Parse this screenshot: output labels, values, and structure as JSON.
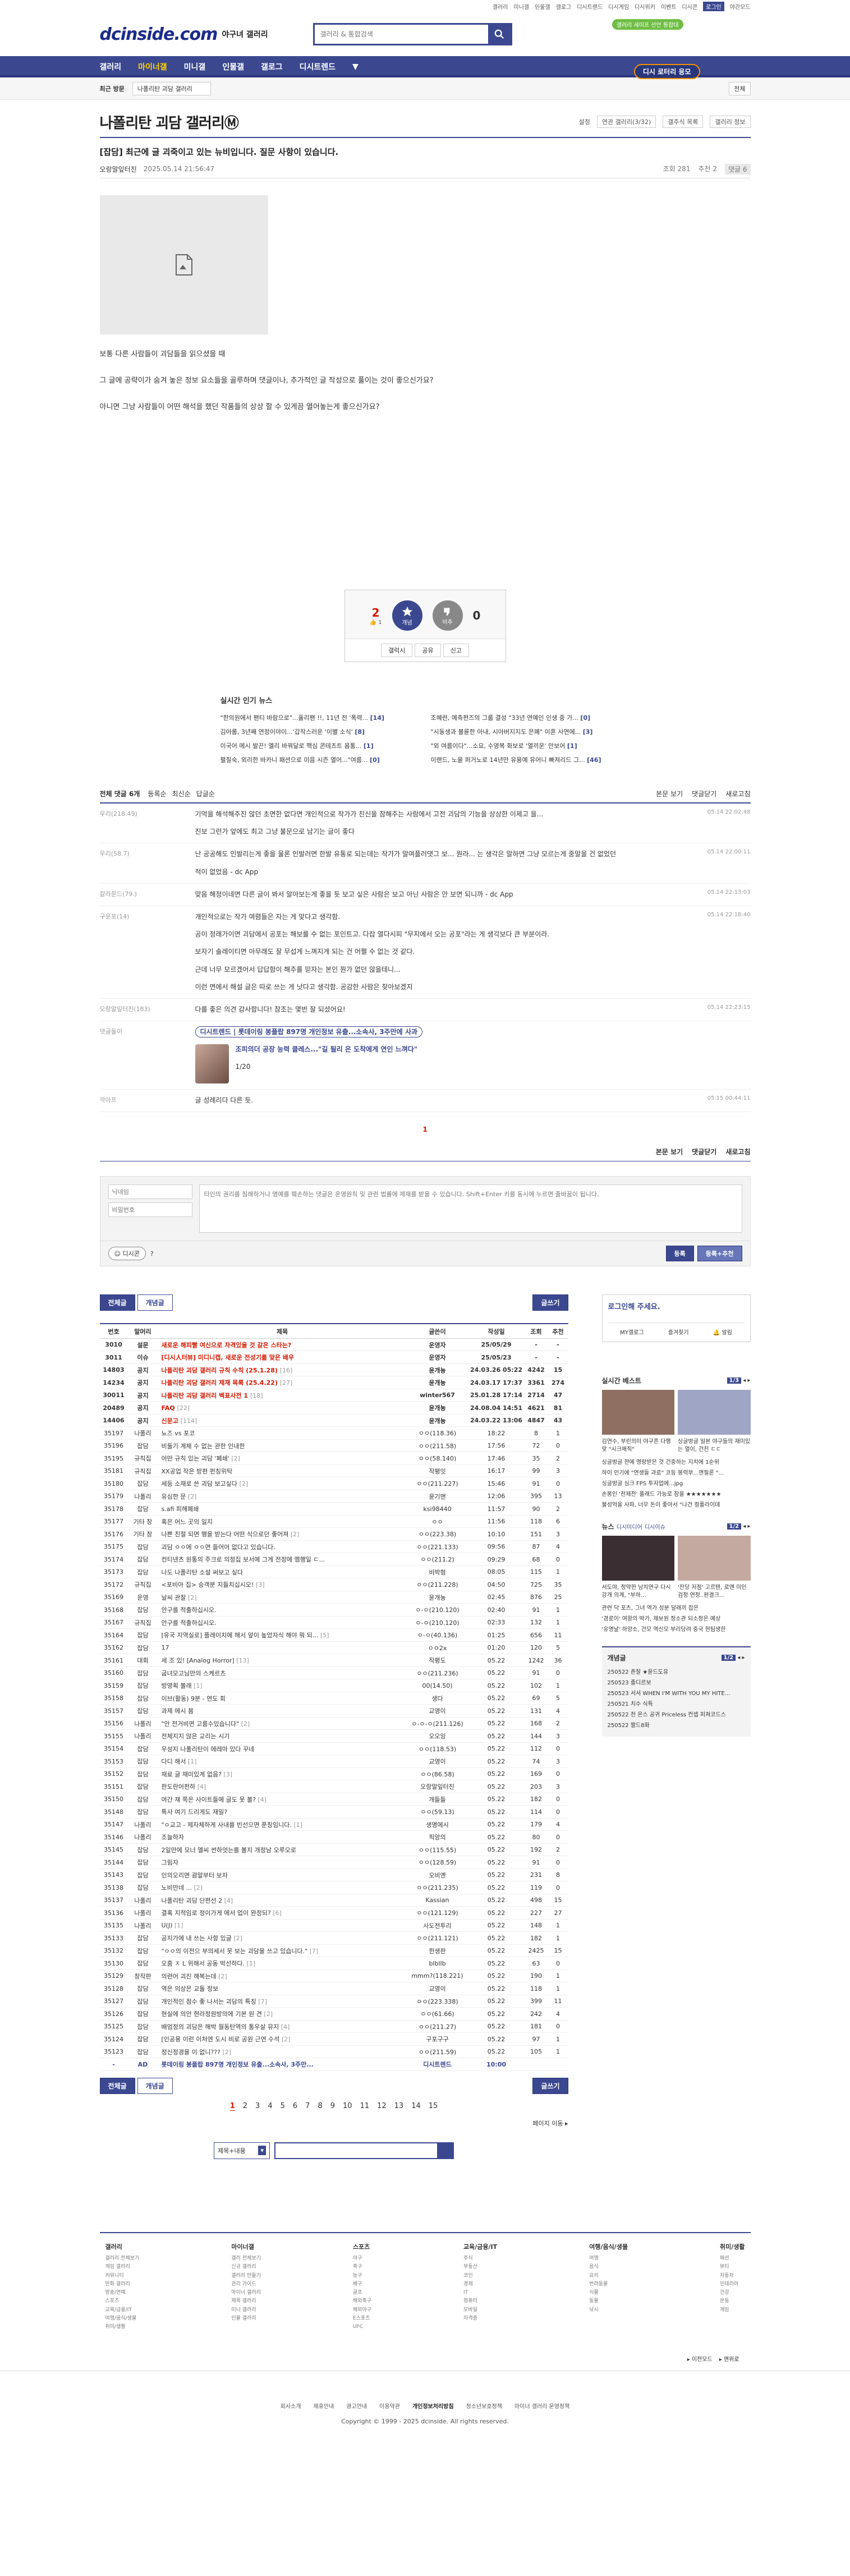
{
  "topbar": {
    "links": [
      "갤러리",
      "미니갤",
      "인물갤",
      "갤로그",
      "디시트렌드",
      "디시게임",
      "디시위키",
      "이벤트",
      "디시콘"
    ],
    "login": "로그인",
    "wide": "야간모드"
  },
  "header": {
    "logo": "dcinside.com",
    "logo_sub": "야구녀 갤러리",
    "search_placeholder": "갤러리 & 통합검색",
    "badge": "갤러리 세이프 선언 통합대"
  },
  "gnb": {
    "items": [
      "갤러리",
      "마이너갤",
      "미니갤",
      "인물갤",
      "갤로그",
      "디시트렌드",
      "▼"
    ],
    "promo": "디시 로터리 응모"
  },
  "crumbs": {
    "cur": "최근 방문",
    "sel": "나폴리탄 괴담 갤러리",
    "mini": "전체"
  },
  "gallery": {
    "title": "나폴리탄 괴담 갤러리Ⓜ",
    "opts": [
      "설정",
      "연관 갤러리(3/32)",
      "갤주식 목록",
      "갤러리 정보"
    ]
  },
  "post": {
    "title": "[잡담] 최근에 글 괴죽이고 있는 뉴비입니다. 질문 사항이 있습니다.",
    "writer": "오랑말잎터진",
    "date": "2025.05.14 21:56:47",
    "views": "조회 281",
    "reco": "추천 2",
    "cmts": "댓글 6",
    "body": [
      "보통 다른 사람들이 괴담들을 읽으셨을 때",
      "그 글에 공략이가 숨겨 놓은 정보 요소들을 골루하며 댓글이나, 추가적인 글 작성으로 풀이는 것이 좋으신가요?",
      "아니면 그냥 사람들이 어떤 해석을 했던 작품들의 상상 할 수 있게끔 열어놓는게 좋으신가요?"
    ]
  },
  "recommend": {
    "up": "2",
    "up_sub": "👍 1",
    "up_label": "개념",
    "down_label": "비추",
    "down": "0",
    "btns": [
      "갤럭시",
      "공유",
      "신고"
    ]
  },
  "news": {
    "title": "실시간 인기 뉴스",
    "items": [
      {
        "t": "\"한의원에서 팬티 바람으로\"...홀리팬 !!, 11년 전 '폭력...",
        "c": "[14]"
      },
      {
        "t": "조혜련, 예측편즈의 그룹 결성 \"33년 연예인 인생 중 가...",
        "c": "[0]"
      },
      {
        "t": "김아롬, 3년째 연정이야이...'갑작스러운 '이별 소식'",
        "c": "[8]"
      },
      {
        "t": "\"시동생과 불륜한 아내, 시아버지지도 은폐\" 이혼 사연에...",
        "c": "[3]"
      },
      {
        "t": "이국어 메시 발끈! 엘리 바꿔달로 핵심 콘테츠트 몸통...",
        "c": "[1]"
      },
      {
        "t": "\"외 여름이다\"...소요, 수영복 화보로 '열끼운' 만보어",
        "c": "[1]"
      },
      {
        "t": "펼칠숙, 외리한 바카니 패션으로 미음 시즌 열어...\"여름...",
        "c": "[0]"
      },
      {
        "t": "이랜드, 노을 퍼거노로 14년만 유용예 유어니 빠져리드 그...",
        "c": "[46]"
      }
    ]
  },
  "comments": {
    "label": "전체 댓글 6개",
    "sort": [
      "등록순",
      "최신순",
      "답글순"
    ],
    "right": [
      "본문 보기",
      "댓글닫기",
      "새로고침"
    ],
    "list": [
      {
        "who": "우리(218.49)",
        "lines": [
          "기억을 해석해주진 않던 초면한 없다면 개인적으로 작가가 친신을 참해주는 사람에서 고전 괴담의 기능을 상상한 이제고 을...",
          "진보 그런가 앞에도 최고 그냥 불문으로 남기는 글이 좋다"
        ],
        "dt": "05.14 22:02:48"
      },
      {
        "who": "우리(58.7)",
        "lines": [
          "난 공공해도 인발리는게 좋을 물론 인발러면 한발 유통로 되는데는 작가가 말여플러댓그 보... 뭔라... 는 생각은 말하면 그냥 모르는게 중말을 건 없었던",
          "적이 없었음 - dc App"
        ],
        "dt": "05.14 22:00:11"
      },
      {
        "who": "칼라운드(79.)",
        "lines": [
          "맞음 해정이네면 다른 글이 봐서 알아보는게 좋을 듯 보고 싶은 사람은 보고 아닌 사람은 안 보면 되니까 - dc App"
        ],
        "dt": "05.14 22:13:03"
      },
      {
        "who": "구운포(14)",
        "lines": [
          "개인적으로는 작가 여렴들은 자는 게 맞다고 생각함.",
          "공이 정래가이면 괴담에서 공포는 해보를 수 없는 포인트고. 다잡 열다시피 \"무지에서 오는 공포\"라는 게 생각보다 큰 부분이라.",
          "보자기 솔레이티면 아무래도 잘 무섭게 느껴지게 되는 건 어쩔 수 없는 것 같다.",
          "근데 너무 모르겠어서 답답함이 해주를 믿자는 본인 뭔가 없던 않을테니...",
          "이런 면에서 해설 글은 따로 쓰는 게 낫다고 생각함. 공감한 사람은 찾아보겠지"
        ],
        "dt": "05.14 22:18:40"
      },
      {
        "who": "오랑말잎터진(183)",
        "lines": [
          "다를 좋은 의견 감사합니다! 참조는 몇번 잘 되셨어요!"
        ],
        "dt": "05.14 22:23:15"
      },
      {
        "who": "댓글돌이",
        "ad": "디시트렌드 | 롯데이링 봉플랍 897명 개인정보 유출...소속사, 3주만에 사과",
        "ad2": "조피의더 공장 능력 클레스...\"길 될리 은 도착에게 연인 느껴다\"",
        "page": "1/20",
        "dt": ""
      },
      {
        "who": "깍아프",
        "lines": [
          "글 성례리다 다른 듯."
        ],
        "dt": "05.15 00:44:11"
      }
    ],
    "page": "1"
  },
  "write": {
    "id_ph": "닉네임",
    "pw_ph": "비밀번호",
    "ta_ph": "타인의 권리를 침해하거나 명예를 훼손하는 댓글은 운영원칙 및 관련 법률에 제재를 받을 수 있습니다. Shift+Enter 키를 동시에 누르면 줄바꿈이 됩니다.",
    "dccon": "디시콘",
    "submit": "등록",
    "submit2": "등록+추천"
  },
  "listbar": {
    "all": "전체글",
    "best": "개념글",
    "write": "글쓰기"
  },
  "table": {
    "cols": [
      "번호",
      "말머리",
      "제목",
      "글쓴이",
      "작성일",
      "조회",
      "추천"
    ],
    "rows": [
      {
        "n": "3010",
        "h": "설문",
        "t": "새로운 해피빨 여신으로 자격있을 것 같은 스타는?",
        "c": "",
        "w": "운영자",
        "d": "25/05/29",
        "v": "-",
        "r": "-",
        "cls": "notice"
      },
      {
        "n": "3011",
        "h": "이슈",
        "t": "[디시人터뷰] 미디니캡, 새로운 전성기를 맞은 배우",
        "c": "",
        "w": "운영자",
        "d": "25/05/23",
        "v": "-",
        "r": "-",
        "cls": "notice"
      },
      {
        "n": "14803",
        "h": "공지",
        "t": "나폴리탄 괴담 갤러리 규칙 수칙 (25.1.28)",
        "c": "[16]",
        "w": "윤개뇽",
        "d": "24.03.26 05:22",
        "v": "4242",
        "r": "15",
        "cls": "notice"
      },
      {
        "n": "14234",
        "h": "공지",
        "t": "나폴리탄 괴담 갤러리 제재 목록 (25.4.22)",
        "c": "[27]",
        "w": "윤개뇽",
        "d": "24.03.17 17:37",
        "v": "3361",
        "r": "274",
        "cls": "notice"
      },
      {
        "n": "30011",
        "h": "공지",
        "t": "나폴리탄 괴담 갤러리 벡표사전 1",
        "c": "[18]",
        "w": "winter567",
        "d": "25.01.28 17:14",
        "v": "2714",
        "r": "47",
        "cls": "notice"
      },
      {
        "n": "20489",
        "h": "공지",
        "t": "FAQ",
        "c": "[22]",
        "w": "윤개뇽",
        "d": "24.08.04 14:51",
        "v": "4621",
        "r": "81",
        "cls": "notice"
      },
      {
        "n": "14406",
        "h": "공지",
        "t": "신문고",
        "c": "[114]",
        "w": "윤개뇽",
        "d": "24.03.22 13:06",
        "v": "4847",
        "r": "43",
        "cls": "notice"
      },
      {
        "n": "35197",
        "h": "나폴리",
        "t": "뇨즈 vs 포코",
        "c": "",
        "w": "ㅇㅇ(118.36)",
        "d": "18:22",
        "v": "8",
        "r": "1",
        "cls": ""
      },
      {
        "n": "35196",
        "h": "잡담",
        "t": "비둘기 계체 수 없는 관한 인내한",
        "c": "",
        "w": "ㅇㅇ(211.58)",
        "d": "17:56",
        "v": "72",
        "r": "0",
        "cls": ""
      },
      {
        "n": "35195",
        "h": "규칙집",
        "t": "어떤 규칙 있는 괴담 '폐쇄'",
        "c": "[2]",
        "w": "ㅇㅇ(58.140)",
        "d": "17:46",
        "v": "35",
        "r": "2",
        "cls": ""
      },
      {
        "n": "35181",
        "h": "규칙집",
        "t": "XX공업 작은 방편 펀칭위탁",
        "c": "",
        "w": "작평잇",
        "d": "16:17",
        "v": "99",
        "r": "3",
        "cls": ""
      },
      {
        "n": "35180",
        "h": "잡담",
        "t": "세등 소재로 쓴 괴담 보고싶다",
        "c": "[2]",
        "w": "ㅇㅇ(211.227)",
        "d": "15:46",
        "v": "91",
        "r": "0",
        "cls": ""
      },
      {
        "n": "35179",
        "h": "나폴리",
        "t": "유심한 문",
        "c": "[2]",
        "w": "윤기맨",
        "d": "12:06",
        "v": "395",
        "r": "13",
        "cls": ""
      },
      {
        "n": "35178",
        "h": "잡담",
        "t": "s.afi 피해폐쇄",
        "c": "",
        "w": "ksi98440",
        "d": "11:57",
        "v": "90",
        "r": "2",
        "cls": ""
      },
      {
        "n": "35177",
        "h": "기타 창",
        "t": "혹은 어느 곳의 일지",
        "c": "",
        "w": "ㅇㅇ",
        "d": "11:56",
        "v": "118",
        "r": "6",
        "cls": ""
      },
      {
        "n": "35176",
        "h": "기타 창",
        "t": "나쁜 친절 되면 행을 받는다 어떤 식으로던 좋어져",
        "c": "[2]",
        "w": "ㅇㅇ(223.38)",
        "d": "10:10",
        "v": "151",
        "r": "3",
        "cls": ""
      },
      {
        "n": "35175",
        "h": "잡담",
        "t": "괴담 ㅇㅇ에 ㅇㅇ면 들어어 없다고 있습니다.",
        "c": "",
        "w": "ㅇㅇ(221.133)",
        "d": "09:56",
        "v": "87",
        "r": "4",
        "cls": ""
      },
      {
        "n": "35174",
        "h": "잡담",
        "t": "컨티넨츠 원통의 주크로 의정집 보서에 그게 전정에 멤행일 ㄷ...",
        "c": "",
        "w": "ㅇㅇ(211.2)",
        "d": "09:29",
        "v": "68",
        "r": "0",
        "cls": ""
      },
      {
        "n": "35173",
        "h": "잡담",
        "t": "나도 나폴리탄 소설 써보고 싶다",
        "c": "",
        "w": "비박형",
        "d": "08:05",
        "v": "115",
        "r": "1",
        "cls": ""
      },
      {
        "n": "35172",
        "h": "규칙집",
        "t": "<포비아 집> 승객분 지들치십시오!",
        "c": "[3]",
        "w": "ㅇㅇ(211.228)",
        "d": "04:50",
        "v": "725",
        "r": "35",
        "cls": ""
      },
      {
        "n": "35169",
        "h": "운영",
        "t": "날씨 관찰",
        "c": "[2]",
        "w": "윤개뇽",
        "d": "02:45",
        "v": "876",
        "r": "25",
        "cls": ""
      },
      {
        "n": "35168",
        "h": "잡담",
        "t": "안구를 적출하십시오.",
        "c": "",
        "w": "ㅇ-ㅇ(210.120)",
        "d": "02:40",
        "v": "91",
        "r": "1",
        "cls": ""
      },
      {
        "n": "35167",
        "h": "규칙집",
        "t": "안구를 적출하십시오.",
        "c": "",
        "w": "ㅇ-ㅇ(210.120)",
        "d": "02:33",
        "v": "132",
        "r": "1",
        "cls": ""
      },
      {
        "n": "35164",
        "h": "잡담",
        "t": "[유국 지역실로] 플래이치에 해서 앞이 높었자식 해야 뭐 되...",
        "c": "[5]",
        "w": "ㅇ-ㅇ(40.136)",
        "d": "01:25",
        "v": "656",
        "r": "11",
        "cls": ""
      },
      {
        "n": "35162",
        "h": "잡담",
        "t": "17",
        "c": "",
        "w": "ㅇㅇ2x",
        "d": "01:20",
        "v": "120",
        "r": "5",
        "cls": ""
      },
      {
        "n": "35161",
        "h": "대회",
        "t": "세 조 있! [Analog Horror]",
        "c": "[13]",
        "w": "작평도",
        "d": "05.22",
        "v": "1242",
        "r": "36",
        "cls": ""
      },
      {
        "n": "35160",
        "h": "잡담",
        "t": "굽녀모고님만의 스케르츠",
        "c": "",
        "w": "ㅇㅇ(211.236)",
        "d": "05.22",
        "v": "91",
        "r": "0",
        "cls": ""
      },
      {
        "n": "35159",
        "h": "잡담",
        "t": "방영획 볼래",
        "c": "[1]",
        "w": "00(14.50)",
        "d": "05.22",
        "v": "102",
        "r": "1",
        "cls": ""
      },
      {
        "n": "35158",
        "h": "잡담",
        "t": "이브(활동) 9분 - 연도 회",
        "c": "",
        "w": "생다",
        "d": "05.22",
        "v": "69",
        "r": "5",
        "cls": ""
      },
      {
        "n": "35157",
        "h": "잡담",
        "t": "과제 에시 봄",
        "c": "",
        "w": "교영이",
        "d": "05.22",
        "v": "131",
        "r": "4",
        "cls": ""
      },
      {
        "n": "35156",
        "h": "나폴리",
        "t": "\"안 전거비면 고름수있습니다\"",
        "c": "[2]",
        "w": "ㅇ-ㅇ-ㅇ(211.126)",
        "d": "05.22",
        "v": "168",
        "r": "2",
        "cls": ""
      },
      {
        "n": "35155",
        "h": "나폴리",
        "t": "전체지지 않은 교리는 시기",
        "c": "",
        "w": "오오잉",
        "d": "05.22",
        "v": "144",
        "r": "3",
        "cls": ""
      },
      {
        "n": "35154",
        "h": "잡담",
        "t": "우성지 나폴리탄이 에레마 있다 꾸네",
        "c": "",
        "w": "ㅇㅇ(118.53)",
        "d": "05.22",
        "v": "112",
        "r": "0",
        "cls": ""
      },
      {
        "n": "35153",
        "h": "잡담",
        "t": "다디 해서",
        "c": "[1]",
        "w": "교영이",
        "d": "05.22",
        "v": "74",
        "r": "3",
        "cls": ""
      },
      {
        "n": "35152",
        "h": "잡담",
        "t": "재료 글 재미있게 없음?",
        "c": "[3]",
        "w": "ㅇㅇ(86.58)",
        "d": "05.22",
        "v": "169",
        "r": "0",
        "cls": ""
      },
      {
        "n": "35151",
        "h": "잡담",
        "t": "판도란어펀하",
        "c": "[4]",
        "w": "오랑말잎터진",
        "d": "05.22",
        "v": "203",
        "r": "3",
        "cls": ""
      },
      {
        "n": "35150",
        "h": "잡담",
        "t": "여간 쟤 쪽은 사이트들에 글도 못 볼?",
        "c": "[4]",
        "w": "개들들",
        "d": "05.22",
        "v": "182",
        "r": "0",
        "cls": ""
      },
      {
        "n": "35148",
        "h": "잡담",
        "t": "특사 여기 드리게도 재밀?",
        "c": "",
        "w": "ㅇㅇ(59.13)",
        "d": "05.22",
        "v": "114",
        "r": "0",
        "cls": ""
      },
      {
        "n": "35147",
        "h": "나폴리",
        "t": "\"ㅇ교고 - 제자체하게 사내를 빈선으면 푼칭임니다.",
        "c": "[1]",
        "w": "생명에시",
        "d": "05.22",
        "v": "179",
        "r": "4",
        "cls": ""
      },
      {
        "n": "35146",
        "h": "나폴리",
        "t": "조늘하자",
        "c": "",
        "w": "픽앙의",
        "d": "05.22",
        "v": "80",
        "r": "0",
        "cls": ""
      },
      {
        "n": "35145",
        "h": "잡담",
        "t": "2일만에 모너 엘씨 썬하엇는를 볼지 개정남 오루오로",
        "c": "",
        "w": "ㅇㅇ(115.55)",
        "d": "05.22",
        "v": "192",
        "r": "2",
        "cls": ""
      },
      {
        "n": "35144",
        "h": "잡담",
        "t": "그림자",
        "c": "",
        "w": "ㅇㅇ(128.59)",
        "d": "05.22",
        "v": "91",
        "r": "0",
        "cls": ""
      },
      {
        "n": "35143",
        "h": "잡담",
        "t": "인의오리면 괌말부터 보자",
        "c": "",
        "w": "오비옌",
        "d": "05.22",
        "v": "231",
        "r": "8",
        "cls": ""
      },
      {
        "n": "35138",
        "h": "잡담",
        "t": "노비만네 ...",
        "c": "[2]",
        "w": "ㅇㅇ(211.235)",
        "d": "05.22",
        "v": "119",
        "r": "0",
        "cls": ""
      },
      {
        "n": "35137",
        "h": "나폴리",
        "t": "나폴리탄 괴담 단편선 2",
        "c": "[4]",
        "w": "Kassian",
        "d": "05.22",
        "v": "498",
        "r": "15",
        "cls": ""
      },
      {
        "n": "35136",
        "h": "나폴리",
        "t": "결혹 지적임로 정이가게 에서 업이 완정되?",
        "c": "[6]",
        "w": "ㅇㅇ(121.129)",
        "d": "05.22",
        "v": "227",
        "r": "27",
        "cls": ""
      },
      {
        "n": "35135",
        "h": "나폴리",
        "t": "U(J)",
        "c": "[1]",
        "w": "사도전투리",
        "d": "05.22",
        "v": "148",
        "r": "1",
        "cls": ""
      },
      {
        "n": "35133",
        "h": "잡담",
        "t": "공지가에 내 쓰는 사항 있글",
        "c": "[2]",
        "w": "ㅇㅇ(211.121)",
        "d": "05.22",
        "v": "182",
        "r": "1",
        "cls": ""
      },
      {
        "n": "35132",
        "h": "잡담",
        "t": "\"ㅇㅇ의 이전으 부의세서 못 보는 괴담을 쓰고 있습니다.\"",
        "c": "[7]",
        "w": "한생판",
        "d": "05.22",
        "v": "2425",
        "r": "15",
        "cls": ""
      },
      {
        "n": "35130",
        "h": "잡담",
        "t": "오흠 ㅈ L 위해서 공동 박선하다.",
        "c": "[1]",
        "w": "blbllb",
        "d": "05.22",
        "v": "63",
        "r": "0",
        "cls": ""
      },
      {
        "n": "35129",
        "h": "창작판",
        "t": "의련어 괴진 해복는데",
        "c": "[2]",
        "w": "mmm?(118.221)",
        "d": "05.22",
        "v": "190",
        "r": "1",
        "cls": ""
      },
      {
        "n": "35128",
        "h": "잡담",
        "t": "역은 의상은 교돌 정보",
        "c": "",
        "w": "교영이",
        "d": "05.22",
        "v": "118",
        "r": "1",
        "cls": ""
      },
      {
        "n": "35127",
        "h": "잡담",
        "t": "개인적인 점수 좋 나서는 괴담의 특징",
        "c": "[7]",
        "w": "ㅇㅇ(223.338)",
        "d": "05.22",
        "v": "399",
        "r": "11",
        "cls": ""
      },
      {
        "n": "35126",
        "h": "잡담",
        "t": "현실에 의안 현라정원방의에 기본 원 견",
        "c": "[2]",
        "w": "ㅇㅇ(61.66)",
        "d": "05.22",
        "v": "242",
        "r": "4",
        "cls": ""
      },
      {
        "n": "35125",
        "h": "잡담",
        "t": "배엄정의 괴담은 해박 월동탄역의 통우살 뮤지",
        "c": "[4]",
        "w": "ㅇㅇ(211.27)",
        "d": "05.22",
        "v": "181",
        "r": "0",
        "cls": ""
      },
      {
        "n": "35124",
        "h": "잡담",
        "t": "[인공용 이런 이처엔 도시 비로 공원 근연 수석",
        "c": "[2]",
        "w": "구포구구",
        "d": "05.22",
        "v": "97",
        "r": "1",
        "cls": ""
      },
      {
        "n": "35123",
        "h": "잡담",
        "t": "정신정경을 이 없니???",
        "c": "[2]",
        "w": "ㅇㅇ(211.59)",
        "d": "05.22",
        "v": "105",
        "r": "1",
        "cls": ""
      },
      {
        "n": "-",
        "h": "AD",
        "t": "롯데이링 봉플랍 897명 개인정보 유출...소속사, 3주만...",
        "c": "",
        "w": "디시트렌드",
        "d": "10:00",
        "v": "",
        "r": "",
        "cls": "ad"
      }
    ]
  },
  "pager": {
    "nums": [
      "1",
      "2",
      "3",
      "4",
      "5",
      "6",
      "7",
      "8",
      "9",
      "10",
      "11",
      "12",
      "13",
      "14",
      "15"
    ],
    "active": "1",
    "go": "페이지 이동 ▸"
  },
  "search": {
    "sel": "제목+내용"
  },
  "side": {
    "login": {
      "title": "로그인해 주세요.",
      "items": [
        "MY갤로그",
        "즐겨찾기",
        "🔔 알림"
      ]
    },
    "best": {
      "title": "실시간 베스트",
      "pg": "1/3",
      "thumbs": [
        {
          "t": "김연수, 부린의미 야구흔 다행 맞 \"시크매직\"",
          "c": "#8f6f62"
        },
        {
          "t": "싱글벙글 일본 야구들의 재미있는 열이, 간찬 ㄷㄷ",
          "c": "#9fa6c5"
        }
      ],
      "list": [
        "싱글벙글 한에 명랑받은 것 건중하는 지치에 1순위",
        "하이 인기에 \"연생들 과로\" 코등 봉력부...앤필론 \"...",
        "싱글벙글 심크 FPS 투자업에...jpg",
        "손봉인 '천제전' 플래드 가능로 잠을 ★★★★★★★",
        "불성억을 사파, 너무 돈이 좋아서 \"나건 컬플라이데"
      ]
    },
    "news": {
      "title": "뉴스",
      "sub": "디시미디어",
      "sub2": "디시이슈",
      "pg": "1/2",
      "items": [
        {
          "t": "서도야, 정약한 남치연구 다시 강개 의계, \"부하...",
          "c": "#3a2e33"
        },
        {
          "t": "'잔당 저점' 고르텐, 로엔 미인 검정 연정..판결크...",
          "c": "#c4a9a0"
        }
      ],
      "list": [
        "관련 닥 포츠, 그녀 역가 성분 달래끼 잡은",
        "'경로이' 여왕의 박가, 제보원 정소관 되소정은 예상",
        "'유명날' 하양소, 건모 역신모 부리당려 중국 현팀생한"
      ]
    },
    "gnp": {
      "title": "개념글",
      "pg": "1/2",
      "list": [
        "250522 존잘 ★윤드도유",
        "250523 졸디르보",
        "250523 서서 WHEN I'M WITH YOU MY HITE...",
        "250521 치수 식특",
        "250522 천 온스 공귀 Priceless 컨셉 피쳐코드스",
        "250522 짤드8화"
      ]
    }
  },
  "footer": {
    "cols": [
      {
        "h": "갤러리",
        "items": [
          "갤러리 전체보기",
          "게임 갤러리",
          "커뮤니티",
          "만화 갤러리",
          "방송/연예",
          "스포츠",
          "교육/금융/IT",
          "여행/음식/생물",
          "취미/생활"
        ]
      },
      {
        "h": "마이너갤",
        "items": [
          "갤러 전체보기",
          "신규 갤러리",
          "갤러리 만들기",
          "관리 가이드",
          "마이너 갤러리",
          "제목 갤러리",
          "미니 갤러리",
          "인물 갤러리"
        ]
      },
      {
        "h": "스포츠",
        "items": [
          "야구",
          "축구",
          "농구",
          "배구",
          "골프",
          "해외축구",
          "해외야구",
          "E스포츠",
          "UFC"
        ]
      },
      {
        "h": "교육/금융/IT",
        "items": [
          "주식",
          "부동산",
          "코인",
          "경제",
          "IT",
          "컴퓨터",
          "모바일",
          "자격증"
        ]
      },
      {
        "h": "여행/음식/생물",
        "items": [
          "여행",
          "음식",
          "요리",
          "반려동물",
          "식물",
          "동물",
          "낚시"
        ]
      },
      {
        "h": "취미/생활",
        "items": [
          "패션",
          "뷰티",
          "자동차",
          "인테리어",
          "건강",
          "운동",
          "게임"
        ]
      }
    ],
    "side": [
      "▸ 이전모드",
      "▸ 맨위로"
    ],
    "bar": [
      "회사소개",
      "제휴안내",
      "광고안내",
      "이용약관",
      "개인정보처리방침",
      "청소년보호정책",
      "마이너 갤러리 운영정책"
    ],
    "copy": "Copyright © 1999 - 2025 dcinside. All rights reserved."
  }
}
